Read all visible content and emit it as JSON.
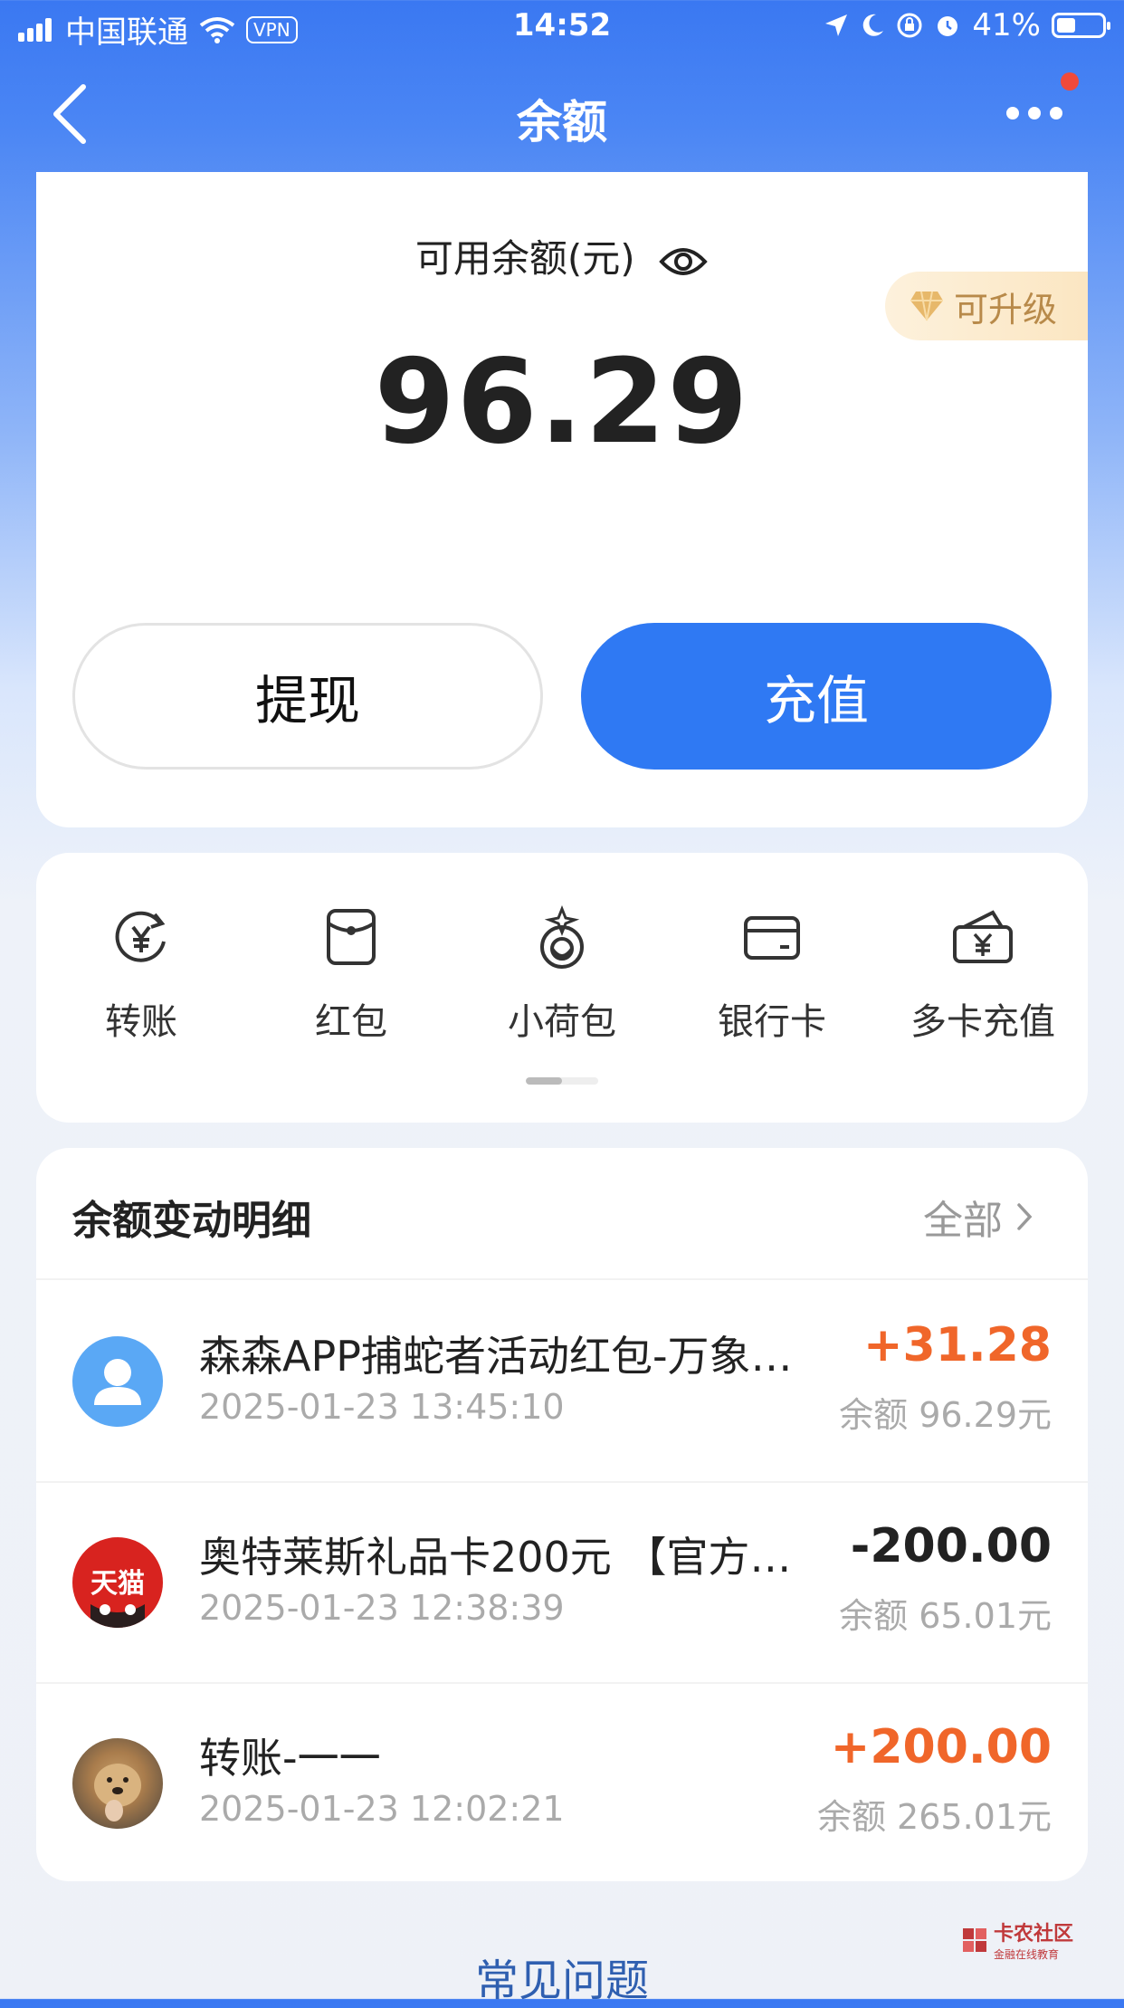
{
  "status_bar": {
    "carrier": "中国联通",
    "vpn": "VPN",
    "time": "14:52",
    "battery": "41%"
  },
  "nav": {
    "title": "余额",
    "back_icon": "chevron-left-icon",
    "more_icon": "more-dots-icon"
  },
  "balance": {
    "label": "可用余额(元)",
    "amount": "96.29",
    "upgrade": "可升级",
    "withdraw": "提现",
    "recharge": "充值"
  },
  "functions": {
    "items": [
      {
        "label": "转账",
        "icon": "transfer-icon"
      },
      {
        "label": "红包",
        "icon": "red-packet-icon"
      },
      {
        "label": "小荷包",
        "icon": "pouch-icon"
      },
      {
        "label": "银行卡",
        "icon": "bank-card-icon"
      },
      {
        "label": "多卡充值",
        "icon": "multi-card-icon"
      }
    ]
  },
  "details": {
    "title": "余额变动明细",
    "all": "全部",
    "records": [
      {
        "name": "森森APP捕蛇者活动红包-万象森…",
        "time": "2025-01-23 13:45:10",
        "amount": "+31.28",
        "balance": "余额 96.29元",
        "type": "income"
      },
      {
        "name": "奥特莱斯礼品卡200元 【官方卡…",
        "time": "2025-01-23 12:38:39",
        "amount": "-200.00",
        "balance": "余额 65.01元",
        "type": "expense"
      },
      {
        "name": "转账-一一",
        "time": "2025-01-23 12:02:21",
        "amount": "+200.00",
        "balance": "余额 265.01元",
        "type": "income"
      }
    ]
  },
  "avatar_badge": "天猫",
  "faq": "常见问题",
  "watermark": {
    "title": "卡农社区",
    "subtitle": "金融在线教育"
  },
  "colors": {
    "primary": "#2f79f3",
    "income": "#f0662a",
    "expense": "#222222"
  }
}
